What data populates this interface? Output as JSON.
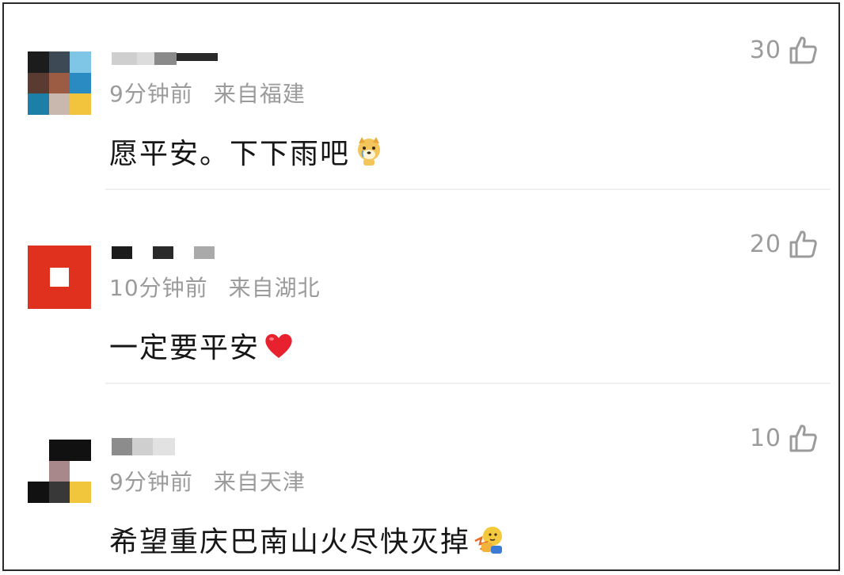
{
  "comments": [
    {
      "time": "9分钟前",
      "location": "来自福建",
      "content": "愿平安。下下雨吧",
      "likes": "30",
      "emoji_icon": "crying-dog-icon",
      "avatar_colors": [
        "#1c1c1c",
        "#3d4a55",
        "#7fc6e6",
        "#5a3b31",
        "#9b5c43",
        "#2a8ac2",
        "#1e7fa6",
        "#c9b8ad",
        "#f2c33c"
      ],
      "username_colors": [
        "#cfcfcf",
        "#dcdcdc",
        "#8a8a8a",
        "#2a2a2a"
      ]
    },
    {
      "time": "10分钟前",
      "location": "来自湖北",
      "content": "一定要平安",
      "likes": "20",
      "emoji_icon": "red-heart-icon",
      "avatar_colors": [
        "#e0301e"
      ],
      "username_colors": [
        "#1c1c1c",
        "#2a2a2a",
        "#aaaaaa"
      ]
    },
    {
      "time": "9分钟前",
      "location": "来自天津",
      "content": "希望重庆巴南山火尽快灭掉",
      "likes": "10",
      "emoji_icon": "fist-bump-icon",
      "avatar_colors": [
        "#ffffff",
        "#111111",
        "#111111",
        "#ffffff",
        "#a8888a",
        "#ffffff",
        "#111111",
        "#383838",
        "#f2c63c"
      ],
      "username_colors": [
        "#8c8c8c",
        "#cfcfcf",
        "#e2e2e2"
      ]
    }
  ]
}
